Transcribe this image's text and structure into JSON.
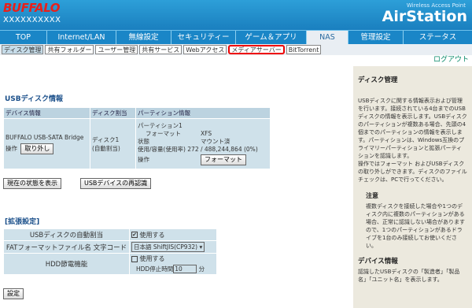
{
  "header": {
    "brand": "BUFFALO",
    "model": "XXXXXXXXXX",
    "product_sub": "Wireless Access Point",
    "product_name": "AirStation"
  },
  "main_tabs": [
    {
      "label": "TOP"
    },
    {
      "label": "Internet/LAN"
    },
    {
      "label": "無線設定"
    },
    {
      "label": "セキュリティー"
    },
    {
      "label": "ゲーム＆アプリ"
    },
    {
      "label": "NAS"
    },
    {
      "label": "管理設定"
    },
    {
      "label": "ステータス"
    }
  ],
  "sub_tabs": [
    {
      "label": "ディスク管理"
    },
    {
      "label": "共有フォルダー"
    },
    {
      "label": "ユーザー管理"
    },
    {
      "label": "共有サービス"
    },
    {
      "label": "Webアクセス"
    },
    {
      "label": "メディアサーバー"
    },
    {
      "label": "BitTorrent"
    }
  ],
  "logout": "ログアウト",
  "usb_section": {
    "title": "USBディスク情報",
    "headers": {
      "device": "デバイス情報",
      "disk": "ディスク割当",
      "partition": "パーティション情報"
    },
    "device_name": "BUFFALO USB-SATA Bridge",
    "operation_label": "操作",
    "detach_button": "取り外し",
    "disk_assign": "ディスク1",
    "disk_assign_mode": "(自動割当)",
    "partition_name": "パーティション1",
    "format_label": "フォーマット",
    "format_value": "XFS",
    "state_label": "状態",
    "state_value": "マウント済",
    "usage_label": "使用/容量(使用率)",
    "usage_value": "272 / 488,244,864 (0%)",
    "partition_op_label": "操作",
    "format_button": "フォーマット",
    "show_status_button": "現在の状態を表示",
    "recognize_button": "USBデバイスの再認識"
  },
  "ext_section": {
    "title": "[拡張設定]",
    "auto_assign_label": "USBディスクの自動割当",
    "auto_assign_value": "使用する",
    "fat_label": "FATフォーマットファイル名 文字コード",
    "fat_value": "日本語 ShiftJIS(CP932)",
    "hdd_label": "HDD節電機能",
    "hdd_check_label": "使用する",
    "hdd_stop_label": "HDD停止時間",
    "hdd_stop_value": "10",
    "hdd_stop_unit": "分",
    "submit_button": "設定"
  },
  "help": {
    "title": "ディスク管理",
    "para1": "USBディスクに関する情報表示および管理を行います。接続されている4台までのUSBディスクの情報を表示します。USBディスクのパーティションが複数ある場合、先頭の4個までのパーティションの情報を表示します。パーティションは、Windows互換のプライマリーパーティションと拡張パーティションを認識します。",
    "para2": "操作ではフォーマット およびUSBディスクの取り外しができます。ディスクのファイルチェックは、PCで行ってください。",
    "note_title": "注意",
    "note_text": "複数ディスクを接続した場合や1つのディスク内に複数のパーティションがある場合、正常に認識しない場合がありますので、1つのパーティションがあるドライブを1台のみ接続してお使いください。",
    "device_title": "デバイス情報",
    "device_text": "認識したUSBディスクの「製造者」「製品名」「ユニット名」を表示します。"
  },
  "colors": {
    "header_blue": "#1a86c7",
    "brand_red": "#e8201a",
    "table_bg": "#cfe1ea",
    "help_bg": "#ece9de",
    "highlight": "#e00000"
  }
}
